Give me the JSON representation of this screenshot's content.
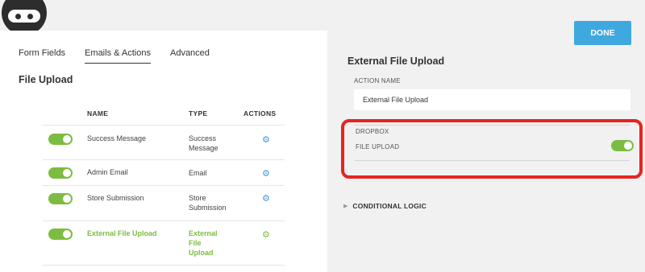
{
  "tabs": [
    {
      "label": "Form Fields"
    },
    {
      "label": "Emails & Actions",
      "active": true
    },
    {
      "label": "Advanced"
    }
  ],
  "left_title": "File Upload",
  "table": {
    "headers": {
      "name": "NAME",
      "type": "TYPE",
      "actions": "ACTIONS"
    },
    "rows": [
      {
        "name": "Success Message",
        "type": "Success Message",
        "enabled": true
      },
      {
        "name": "Admin Email",
        "type": "Email",
        "enabled": true
      },
      {
        "name": "Store Submission",
        "type": "Store Submission",
        "enabled": true
      },
      {
        "name": "External File Upload",
        "type": "External File Upload",
        "enabled": true,
        "highlight": true
      }
    ]
  },
  "done_label": "DONE",
  "right_title": "External File Upload",
  "action_name_label": "ACTION NAME",
  "action_name_value": "External File Upload",
  "dropbox": {
    "section_label": "DROPBOX",
    "file_upload_label": "FILE UPLOAD",
    "file_upload_enabled": true
  },
  "conditional_logic": "CONDITIONAL LOGIC",
  "colors": {
    "accent": "#3fa9df",
    "toggle_on": "#7cbd41",
    "highlight_border": "#e8231e"
  },
  "icons": {
    "gear": "gear-icon",
    "collapse": "triangle-right-icon"
  }
}
